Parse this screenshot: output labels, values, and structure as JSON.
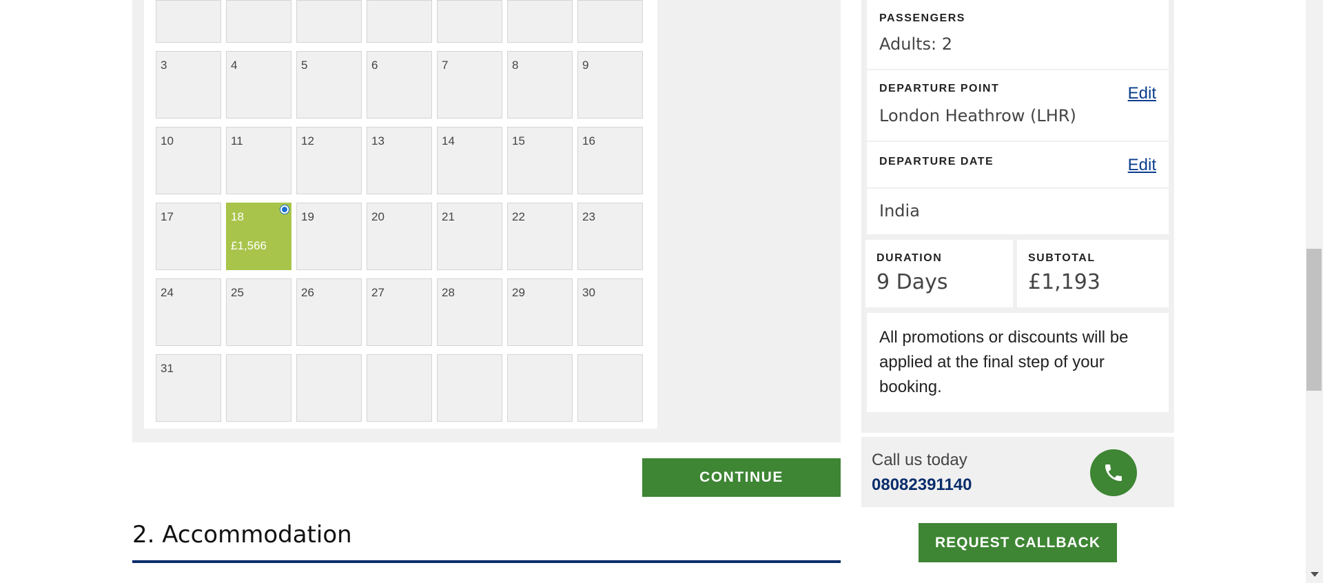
{
  "calendar": {
    "weeks": [
      [
        "",
        "",
        "",
        "",
        "",
        "",
        ""
      ],
      [
        "3",
        "4",
        "5",
        "6",
        "7",
        "8",
        "9"
      ],
      [
        "10",
        "11",
        "12",
        "13",
        "14",
        "15",
        "16"
      ],
      [
        "17",
        "18",
        "19",
        "20",
        "21",
        "22",
        "23"
      ],
      [
        "24",
        "25",
        "26",
        "27",
        "28",
        "29",
        "30"
      ],
      [
        "31",
        "",
        "",
        "",
        "",
        "",
        ""
      ]
    ],
    "selected_day": "18",
    "selected_price": "£1,566"
  },
  "continue_label": "CONTINUE",
  "section": {
    "title": "2. Accommodation"
  },
  "summary": {
    "passengers_label": "PASSENGERS",
    "passengers_value": "Adults: 2",
    "departure_point_label": "DEPARTURE POINT",
    "departure_point_value": "London Heathrow (LHR)",
    "departure_date_label": "DEPARTURE DATE",
    "destination_value": "India",
    "edit_label": "Edit",
    "duration_label": "DURATION",
    "duration_value": "9 Days",
    "subtotal_label": "SUBTOTAL",
    "subtotal_value": "£1,193",
    "promo_text": "All promotions or discounts will be applied at the final step of your booking."
  },
  "call": {
    "text": "Call us today",
    "number": "08082391140",
    "callback_label": "REQUEST CALLBACK"
  },
  "colors": {
    "accent_green": "#3e8534",
    "selected_day": "#a8c44a",
    "link_blue": "#0a3d8c",
    "rule_navy": "#0a2d6b"
  },
  "icons": [
    "phone-icon",
    "radio-selected-icon",
    "scroll-down-arrow-icon"
  ]
}
